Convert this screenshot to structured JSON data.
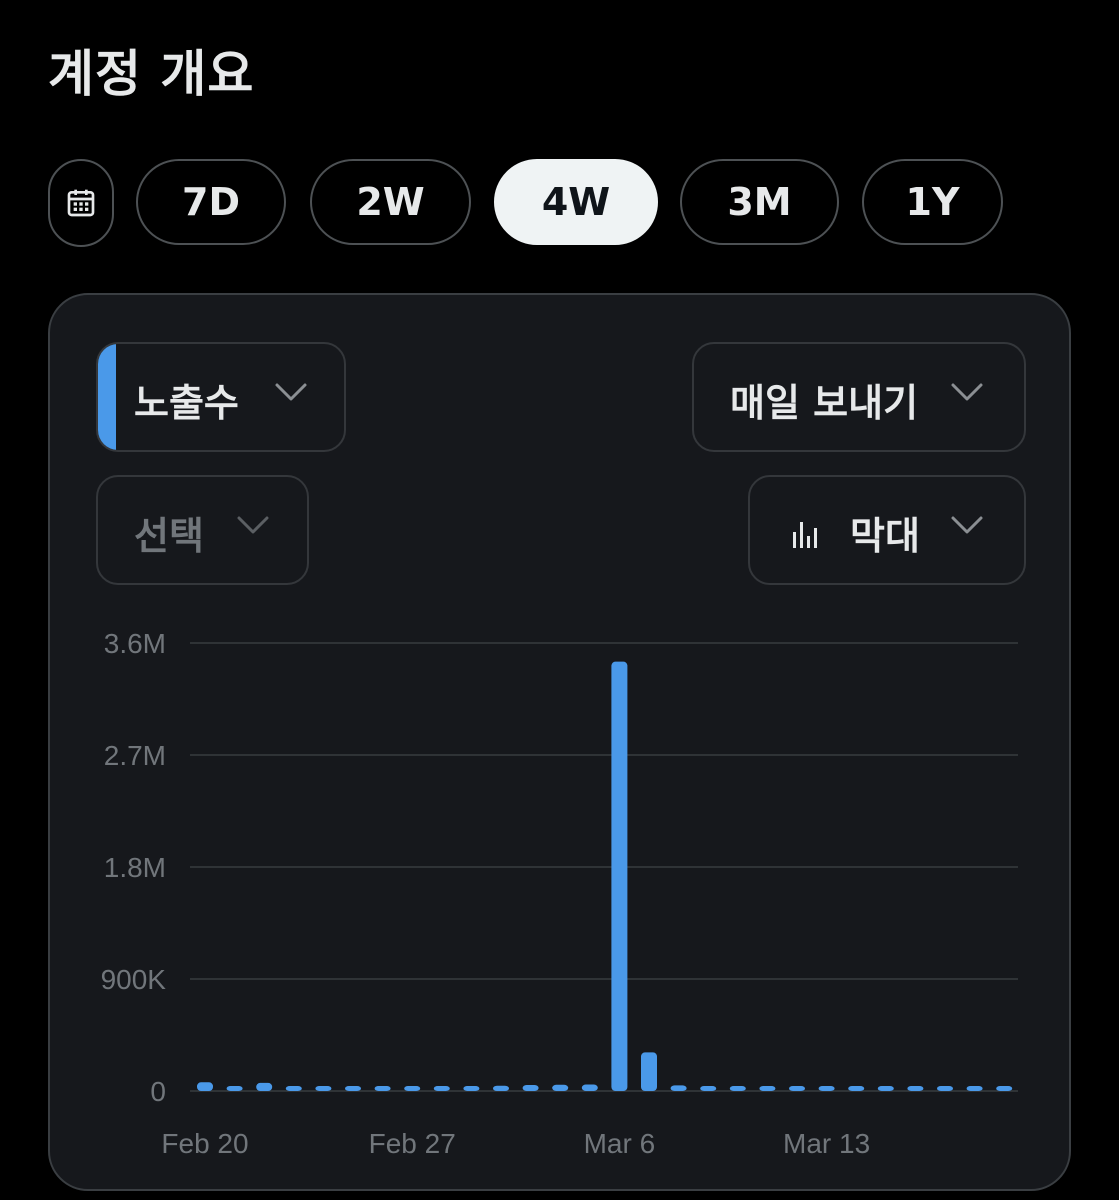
{
  "header": {
    "title": "계정 개요"
  },
  "range": {
    "calendar_icon": "calendar-icon",
    "options": [
      "7D",
      "2W",
      "4W",
      "3M",
      "1Y"
    ],
    "selected": "4W"
  },
  "controls": {
    "metric": "노출수",
    "metric_color": "#4a99e9",
    "export": "매일 보내기",
    "compare": "선택",
    "chart_type": "막대",
    "chart_type_icon": "bar-chart-icon",
    "chevron_icon": "chevron-down-icon"
  },
  "chart_data": {
    "type": "bar",
    "y_ticks": [
      "0",
      "900K",
      "1.8M",
      "2.7M",
      "3.6M"
    ],
    "x_ticks": [
      "Feb 20",
      "Feb 27",
      "Mar 6",
      "Mar 13"
    ],
    "ylim": [
      0,
      3600000
    ],
    "series": [
      {
        "values": [
          70000,
          22000,
          65000,
          30000,
          15000,
          12000,
          18000,
          20000,
          38000,
          32000,
          42000,
          48000,
          50000,
          52000,
          3450000,
          310000,
          45000,
          15000,
          12000,
          12000,
          10000,
          12000,
          15000,
          12000,
          8000,
          10000,
          10000,
          8000
        ],
        "color": "#4a99e9"
      }
    ],
    "grid": true
  }
}
